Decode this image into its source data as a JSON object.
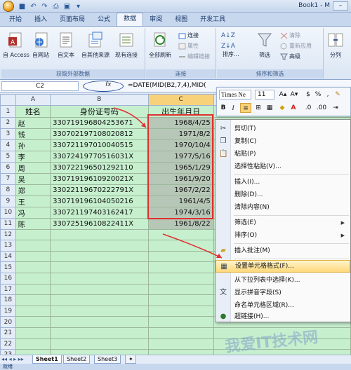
{
  "title_bar": {
    "book_title": "Book1 - M"
  },
  "ribbon_tabs": [
    "开始",
    "插入",
    "页面布局",
    "公式",
    "数据",
    "审阅",
    "视图",
    "开发工具"
  ],
  "active_tab": "数据",
  "ribbon": {
    "get_external": {
      "from_access": "自 Access",
      "from_web": "自网站",
      "from_text": "自文本",
      "from_other": "自其他来源",
      "existing": "现有连接",
      "label": "获取外部数据"
    },
    "connections": {
      "refresh_all": "全部刷新",
      "connections": "连接",
      "properties": "属性",
      "edit_links": "编辑链接",
      "label": "连接"
    },
    "sort_filter": {
      "sort": "排序...",
      "filter": "筛选",
      "clear": "清除",
      "reapply": "重新应用",
      "advanced": "高级",
      "label": "排序和筛选"
    },
    "tools": {
      "split": "分列"
    }
  },
  "formula_bar": {
    "name_box": "C2",
    "fx": "fx",
    "formula": "=DATE(MID(B2,7,4),MID("
  },
  "sheet": {
    "col_headers": [
      "A",
      "B",
      "C"
    ],
    "header_row": {
      "name": "姓名",
      "id": "身份证号码",
      "dob": "出生年月日"
    },
    "rows": [
      {
        "n": "1"
      },
      {
        "n": "2",
        "name": "赵",
        "id": "330719196804253671",
        "dob": "1968/4/25"
      },
      {
        "n": "3",
        "name": "钱",
        "id": "330702197108020812",
        "dob": "1971/8/2"
      },
      {
        "n": "4",
        "name": "孙",
        "id": "330721197010040515",
        "dob": "1970/10/4"
      },
      {
        "n": "5",
        "name": "李",
        "id": "33072419770516031X",
        "dob": "1977/5/16"
      },
      {
        "n": "6",
        "name": "周",
        "id": "330722196501292110",
        "dob": "1965/1/29"
      },
      {
        "n": "7",
        "name": "吴",
        "id": "33071919610920021X",
        "dob": "1961/9/20"
      },
      {
        "n": "8",
        "name": "郑",
        "id": "33022119670222791X",
        "dob": "1967/2/22"
      },
      {
        "n": "9",
        "name": "王",
        "id": "330719196104050216",
        "dob": "1961/4/5"
      },
      {
        "n": "10",
        "name": "冯",
        "id": "330721197403162417",
        "dob": "1974/3/16"
      },
      {
        "n": "11",
        "name": "陈",
        "id": "33072519610822411X",
        "dob": "1961/8/22"
      },
      {
        "n": "12"
      },
      {
        "n": "13"
      },
      {
        "n": "14"
      },
      {
        "n": "15"
      },
      {
        "n": "16"
      },
      {
        "n": "17"
      },
      {
        "n": "18"
      },
      {
        "n": "19"
      },
      {
        "n": "20"
      },
      {
        "n": "21"
      },
      {
        "n": "22"
      },
      {
        "n": "23"
      }
    ]
  },
  "mini_toolbar": {
    "font": "Times Ne",
    "size": "11"
  },
  "context_menu": {
    "items": [
      "剪切(T)",
      "复制(C)",
      "粘贴(P)",
      "选择性粘贴(V)...",
      "插入(I)...",
      "删除(D)...",
      "清除内容(N)",
      "筛选(E)",
      "排序(O)",
      "插入批注(M)",
      "设置单元格格式(F)...",
      "从下拉列表中选择(K)...",
      "显示拼音字段(S)",
      "命名单元格区域(R)...",
      "超链接(H)..."
    ],
    "highlighted": "设置单元格格式(F)..."
  },
  "sheet_tabs": [
    "Sheet1",
    "Sheet2",
    "Sheet3"
  ],
  "status_text": "就绪",
  "watermark": "我爱IT技术网"
}
